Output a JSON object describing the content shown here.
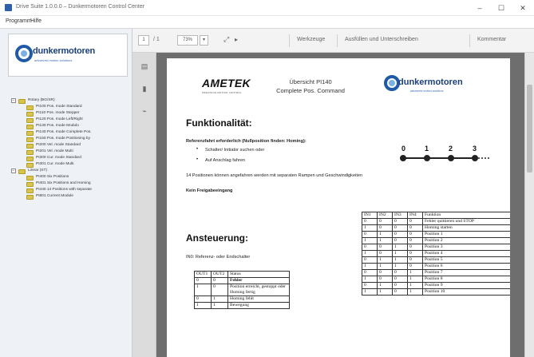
{
  "window": {
    "title": "Drive Suite 1.0.0.0 – Dunkermotoren Control Center",
    "minimize": "–",
    "maximize": "☐",
    "close": "✕"
  },
  "menu": {
    "items": [
      "Programm",
      "Hilfe"
    ]
  },
  "sidebar": {
    "logo_text": "dunkermotoren",
    "logo_tagline": "advanced motion solutions",
    "tree": [
      {
        "label": "Rotary (BG/SR)",
        "level": 0,
        "expander": "−"
      },
      {
        "label": "PI100 Pos. mode Standard",
        "level": 1
      },
      {
        "label": "PI110 Pos. mode Stepper",
        "level": 1
      },
      {
        "label": "PI120 Pos. mode Left/Right",
        "level": 1
      },
      {
        "label": "PI130 Pos. mode Modulo",
        "level": 1
      },
      {
        "label": "PI140 Pos. mode Complete Pos.",
        "level": 1
      },
      {
        "label": "PI150 Pos. mode Positioning by",
        "level": 1
      },
      {
        "label": "PI200 Vel. mode Standard",
        "level": 1
      },
      {
        "label": "PI201 Vel. mode Multi",
        "level": 1
      },
      {
        "label": "PI300 Cur. mode Standard",
        "level": 1
      },
      {
        "label": "PI301 Cur. mode Multi",
        "level": 1
      },
      {
        "label": "Linear (ST)",
        "level": 0,
        "expander": "−"
      },
      {
        "label": "PI400 Six Positions",
        "level": 1
      },
      {
        "label": "PI401 Six Positions and Homing",
        "level": 1
      },
      {
        "label": "PI440 14 Positions with separate",
        "level": 1
      },
      {
        "label": "PI801 Current Module",
        "level": 1
      }
    ]
  },
  "toolbar": {
    "page_current": "1",
    "page_total": "/ 1",
    "zoom": "73%",
    "zoom_arrow": "▾",
    "tools": "Werkzeuge",
    "fill_sign": "Ausfüllen und Unterschreiben",
    "comment": "Kommentar"
  },
  "document": {
    "ametek_logo": "AMETEK",
    "ametek_sub": "PRECISION MOTION CONTROL",
    "header_line1": "Übersicht PI140",
    "header_line2": "Complete Pos. Command",
    "dk_logo": "dunkermotoren",
    "dk_tag": "advanced motion solutions",
    "section1": "Funktionalität:",
    "line_ref": "Referenzfahrt erforderlich (Nullposition finden: Homing):",
    "bullet1": "Schalter/ Initiator suchen oder",
    "bullet2": "Auf Anschlag fahren",
    "positions_line": "14 Positionen können angefahren werden mit separaten Rampen und Geschwindigkeiten",
    "kein": "Kein Freigabeeingang",
    "section2": "Ansteuerung:",
    "ini_line": "IN0: Referenz- oder Endschalter",
    "axis_labels": [
      "0",
      "1",
      "2",
      "3"
    ],
    "out_table": {
      "header": [
        "OUT1",
        "OUT2",
        "Status"
      ],
      "rows": [
        [
          "0",
          "0",
          "Fehler"
        ],
        [
          "1",
          "0",
          "Position erreicht, gestoppt oder Homing fertig"
        ],
        [
          "0",
          "1",
          "Homing fehlt"
        ],
        [
          "1",
          "1",
          "Bewegung"
        ]
      ]
    },
    "in_table": {
      "header": [
        "IN1",
        "IN2",
        "IN3",
        "IN4",
        "Funktion"
      ],
      "rows": [
        [
          "0",
          "0",
          "0",
          "0",
          "Fehler quittieren und STOP"
        ],
        [
          "1",
          "0",
          "0",
          "0",
          "Homing starten"
        ],
        [
          "0",
          "1",
          "0",
          "0",
          "Position 1"
        ],
        [
          "1",
          "1",
          "0",
          "0",
          "Position 2"
        ],
        [
          "0",
          "0",
          "1",
          "0",
          "Position 3"
        ],
        [
          "1",
          "0",
          "1",
          "0",
          "Position 4"
        ],
        [
          "0",
          "1",
          "1",
          "0",
          "Position 5"
        ],
        [
          "1",
          "1",
          "1",
          "0",
          "Position 6"
        ],
        [
          "0",
          "0",
          "0",
          "1",
          "Position 7"
        ],
        [
          "1",
          "0",
          "0",
          "1",
          "Position 8"
        ],
        [
          "0",
          "1",
          "0",
          "1",
          "Position 9"
        ],
        [
          "1",
          "1",
          "0",
          "1",
          "Position 10"
        ]
      ]
    }
  }
}
